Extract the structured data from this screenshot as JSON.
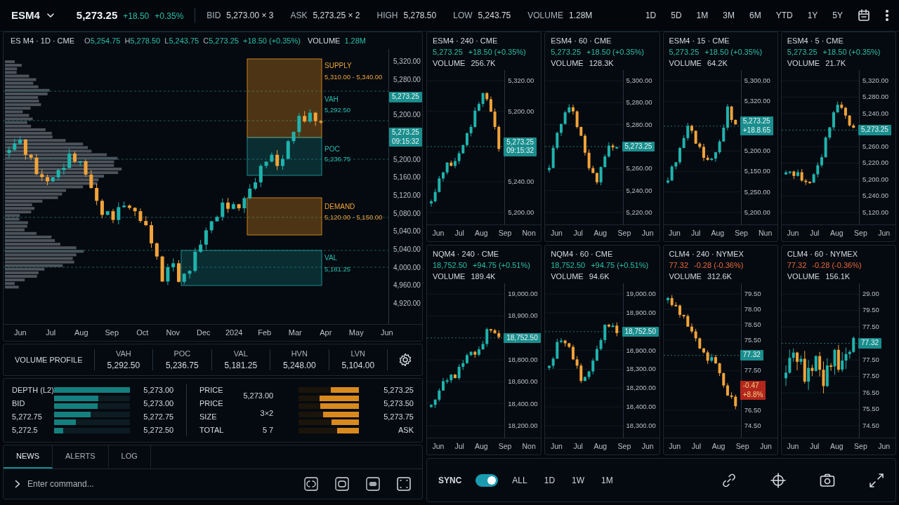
{
  "topbar": {
    "symbol": "ESM4",
    "price": "5,273.25",
    "change": "+18.50",
    "change_pct": "+0.35%",
    "stats": [
      {
        "label": "BID",
        "value": "5,273.00 × 3"
      },
      {
        "label": "ASK",
        "value": "5,273.25 × 2"
      },
      {
        "label": "HIGH",
        "value": "5,278.50"
      },
      {
        "label": "LOW",
        "value": "5,243.75"
      },
      {
        "label": "VOLUME",
        "value": "1.28M"
      }
    ],
    "ranges": [
      "1D",
      "5D",
      "1M",
      "3M",
      "6M",
      "YTD",
      "1Y",
      "5Y"
    ]
  },
  "main_chart": {
    "title": "ES M4 · 1D · CME",
    "ohlc": [
      {
        "label": "O",
        "value": "5,254.75"
      },
      {
        "label": "H",
        "value": "5,278.50"
      },
      {
        "label": "L",
        "value": "5,243.75"
      },
      {
        "label": "C",
        "value": "5,273.25"
      }
    ],
    "change": "+18.50 (+0.35%)",
    "volume_label": "VOLUME",
    "volume": "1.28M",
    "zones": [
      {
        "kind": "supply",
        "label": "SUPPLY",
        "value": "5,310.00 - 5,340.00"
      },
      {
        "kind": "level",
        "label": "VAH",
        "value": "5,292.50"
      },
      {
        "kind": "value_area",
        "label": "POC",
        "value": "5,236.75"
      },
      {
        "kind": "demand",
        "label": "DEMAND",
        "value": "5,120.00 - 5,150.00"
      },
      {
        "kind": "value_area",
        "label": "VAL",
        "value": "5,181.25"
      }
    ],
    "axis": [
      {
        "kind": "tick",
        "text": "5,320.00"
      },
      {
        "kind": "tick",
        "text": "5,280.00"
      },
      {
        "kind": "tag",
        "lines": [
          "5,273.25"
        ]
      },
      {
        "kind": "tick",
        "text": "5,200.00"
      },
      {
        "kind": "tag",
        "lines": [
          "5,273.25",
          "09:15:32"
        ]
      },
      {
        "kind": "tick",
        "text": "5,200.00"
      },
      {
        "kind": "tick",
        "text": "5,160.00"
      },
      {
        "kind": "tick",
        "text": "5,120.00"
      },
      {
        "kind": "tick",
        "text": "5,080.00"
      },
      {
        "kind": "tick",
        "text": "5,040.00"
      },
      {
        "kind": "tick",
        "text": "5,040.00"
      },
      {
        "kind": "tick",
        "text": "4,000.00"
      },
      {
        "kind": "tick",
        "text": "4,960.00"
      },
      {
        "kind": "tick",
        "text": "4,920.00"
      }
    ],
    "xlabels": [
      "Jun",
      "Jul",
      "Aug",
      "Sep",
      "Oct",
      "Nov",
      "Dec",
      "2024",
      "Feb",
      "Mar",
      "Apr",
      "May",
      "Jun"
    ]
  },
  "volume_profile": {
    "title": "VOLUME PROFILE",
    "stats": [
      {
        "label": "VAH",
        "value": "5,292.50"
      },
      {
        "label": "POC",
        "value": "5,236.75"
      },
      {
        "label": "VAL",
        "value": "5,181.25"
      },
      {
        "label": "HVN",
        "value": "5,248.00"
      },
      {
        "label": "LVN",
        "value": "5,104.00"
      }
    ]
  },
  "depth": {
    "bid_rows": [
      {
        "label": "DEPTH (L2)",
        "price": "5,273.00"
      },
      {
        "label": "BID",
        "price": "5,273.00"
      },
      {
        "label": "5,272.75",
        "price": "5,272.75"
      },
      {
        "label": "5,272.5",
        "price": "5,272.50"
      }
    ],
    "bid_bars": [
      {
        "level": 1
      },
      {
        "level": 0.58
      },
      {
        "level": 0.57
      },
      {
        "level": 0.48
      },
      {
        "level": 0.28
      },
      {
        "level": 0.12
      }
    ],
    "ask_rows": [
      {
        "label": "PRICE",
        "price": "5,273.25"
      },
      {
        "label": "PRICE",
        "value": "5,273.00",
        "price": "5,273.50"
      },
      {
        "label": "SIZE",
        "value": "3×2",
        "price": "5,273.75"
      },
      {
        "label": "TOTAL",
        "value": "5 7",
        "price": "ASK"
      }
    ],
    "ask_bars": [
      {
        "level": 0.47
      },
      {
        "level": 0.66
      },
      {
        "level": 0.64
      },
      {
        "level": 0.6
      },
      {
        "level": 0.46
      },
      {
        "level": 0.36
      }
    ]
  },
  "tabs": [
    {
      "label": "NEWS",
      "selected": true
    },
    {
      "label": "ALERTS",
      "selected": false
    },
    {
      "label": "LOG",
      "selected": false
    }
  ],
  "command": {
    "placeholder": "Enter command..."
  },
  "mini_charts": [
    {
      "title": "ESM4 · 240 · CME",
      "price": "5,273.25",
      "change": "+18.50 (+0.35%)",
      "color": "#2bbfa6",
      "volume_label": "VOLUME",
      "volume": "256.7K",
      "axis": [
        {
          "kind": "tick",
          "text": "5,320.00"
        },
        {
          "kind": "tick",
          "text": "5,200.00"
        },
        {
          "kind": "tag",
          "lines": [
            "5,273.25",
            "09:15:32"
          ]
        },
        {
          "kind": "tick",
          "text": "5,240.00"
        },
        {
          "kind": "tick",
          "text": "5,200.00"
        }
      ],
      "xlabels": [
        "Jun",
        "Jul",
        "Aug",
        "Sep",
        "Non"
      ]
    },
    {
      "title": "ESM4 · 60 · CME",
      "price": "5,273.25",
      "change": "+18.50 (+0.35%)",
      "color": "#2bbfa6",
      "volume_label": "VOLUME",
      "volume": "128.3K",
      "axis": [
        {
          "kind": "tick",
          "text": "5,300.00"
        },
        {
          "kind": "tick",
          "text": "5,280.00"
        },
        {
          "kind": "tick",
          "text": "5,280.00"
        },
        {
          "kind": "tag",
          "lines": [
            "5,273.25"
          ]
        },
        {
          "kind": "tick",
          "text": "5,260.00"
        },
        {
          "kind": "tick",
          "text": "5,240.00"
        },
        {
          "kind": "tick",
          "text": "5,220.00"
        }
      ],
      "xlabels": [
        "Jun",
        "Jul",
        "Aug",
        "Sep",
        "Jun"
      ]
    },
    {
      "title": "ESM4 · 15 · CME",
      "price": "5,273.25",
      "change": "+18.50 (+0.35%)",
      "color": "#2bbfa6",
      "volume_label": "VOLUME",
      "volume": "64.2K",
      "axis": [
        {
          "kind": "tick",
          "text": "5,300.00"
        },
        {
          "kind": "tick",
          "text": "5,320.00"
        },
        {
          "kind": "tag",
          "lines": [
            "5,273.25",
            "+18.8.65"
          ]
        },
        {
          "kind": "tick",
          "text": "5,200.00"
        },
        {
          "kind": "tick",
          "text": "5,150.00"
        },
        {
          "kind": "tick",
          "text": "5,250.00"
        },
        {
          "kind": "tick",
          "text": "5,200.00"
        }
      ],
      "xlabels": [
        "Jun",
        "Jul",
        "Aug",
        "Sep",
        "Nun"
      ]
    },
    {
      "title": "ESM4 · 5 · CME",
      "price": "5,273.25",
      "change": "+18.50 (+0.35%)",
      "color": "#2bbfa6",
      "volume_label": "VOLUME",
      "volume": "21.7K",
      "axis": [
        {
          "kind": "tick",
          "text": "5,320.00"
        },
        {
          "kind": "tick",
          "text": "5,280.00"
        },
        {
          "kind": "tick",
          "text": "5,240.00"
        },
        {
          "kind": "tag",
          "lines": [
            "5,273.25"
          ]
        },
        {
          "kind": "tick",
          "text": "5,260.00"
        },
        {
          "kind": "tick",
          "text": "5,220.00"
        },
        {
          "kind": "tick",
          "text": "5,200.00"
        },
        {
          "kind": "tick",
          "text": "5,240.00"
        },
        {
          "kind": "tick",
          "text": "5,120.00"
        }
      ],
      "xlabels": [
        "Jun",
        "Jul",
        "Aug",
        "Sep",
        "Jun"
      ]
    },
    {
      "title": "NQM4 · 240 · CME",
      "price": "18,752.50",
      "change": "+94.75 (+0.51%)",
      "color": "#2bbfa6",
      "volume_label": "VOLUME",
      "volume": "189.4K",
      "axis": [
        {
          "kind": "tick",
          "text": "19,000.00"
        },
        {
          "kind": "tick",
          "text": "18,900.00"
        },
        {
          "kind": "tag",
          "lines": [
            "18,752.50"
          ]
        },
        {
          "kind": "tick",
          "text": "18,800.00"
        },
        {
          "kind": "tick",
          "text": "18,600.00"
        },
        {
          "kind": "tick",
          "text": "18,400.00"
        },
        {
          "kind": "tick",
          "text": "18,200.00"
        }
      ],
      "xlabels": [
        "Jun",
        "Jul",
        "Aug",
        "Sep",
        "Non"
      ]
    },
    {
      "title": "NQM4 · 60 · CME",
      "price": "18,752.50",
      "change": "+94.75 (+0.51%)",
      "color": "#2bbfa6",
      "volume_label": "VOLUME",
      "volume": "94.6K",
      "axis": [
        {
          "kind": "tick",
          "text": "19,000.00"
        },
        {
          "kind": "tick",
          "text": "18,900.00"
        },
        {
          "kind": "tag",
          "lines": [
            "18,752.50"
          ]
        },
        {
          "kind": "tick",
          "text": "18,900.00"
        },
        {
          "kind": "tick",
          "text": "18,300.00"
        },
        {
          "kind": "tick",
          "text": "18,200.00"
        },
        {
          "kind": "tick",
          "text": "18,400.00"
        },
        {
          "kind": "tick",
          "text": "18,300.00"
        }
      ],
      "xlabels": [
        "Jun",
        "Jul",
        "Aug",
        "Sep",
        "Jun"
      ]
    },
    {
      "title": "CLM4 · 240 · NYMEX",
      "price": "77.32",
      "change": "-0.28 (-0.36%)",
      "color": "#e8683a",
      "volume_label": "VOLUME",
      "volume": "312.6K",
      "axis": [
        {
          "kind": "tick",
          "text": "79.50"
        },
        {
          "kind": "tick",
          "text": "78.00"
        },
        {
          "kind": "tick",
          "text": "78.50"
        },
        {
          "kind": "tick",
          "text": "75.50"
        },
        {
          "kind": "tag",
          "lines": [
            "77.32"
          ]
        },
        {
          "kind": "tick",
          "text": "77.50"
        },
        {
          "kind": "alert",
          "lines": [
            "-0.47",
            "+8.8%"
          ]
        },
        {
          "kind": "tick",
          "text": "76.50"
        },
        {
          "kind": "tick",
          "text": "74.50"
        }
      ],
      "xlabels": [
        "Jun",
        "Jul",
        "Aug",
        "Sep",
        "Jun"
      ]
    },
    {
      "title": "CLM4 · 60 · NYMEX",
      "price": "77.32",
      "change": "-0.28 (-0.36%)",
      "color": "#e8683a",
      "volume_label": "VOLUME",
      "volume": "156.1K",
      "axis": [
        {
          "kind": "tick",
          "text": "29.00"
        },
        {
          "kind": "tick",
          "text": "79.50"
        },
        {
          "kind": "tick",
          "text": "77.50"
        },
        {
          "kind": "tag",
          "lines": [
            "77.32"
          ]
        },
        {
          "kind": "tick",
          "text": "77.50"
        },
        {
          "kind": "tick",
          "text": "77.50"
        },
        {
          "kind": "tick",
          "text": "76.50"
        },
        {
          "kind": "tick",
          "text": "75.50"
        },
        {
          "kind": "tick",
          "text": "74.50"
        }
      ],
      "xlabels": [
        "Jun",
        "Jul",
        "Aug",
        "Sep",
        "Jun"
      ]
    }
  ],
  "bottom_bar": {
    "sync": {
      "label": "SYNC",
      "on": true
    },
    "ranges": [
      "ALL",
      "1D",
      "1W",
      "1M"
    ]
  }
}
